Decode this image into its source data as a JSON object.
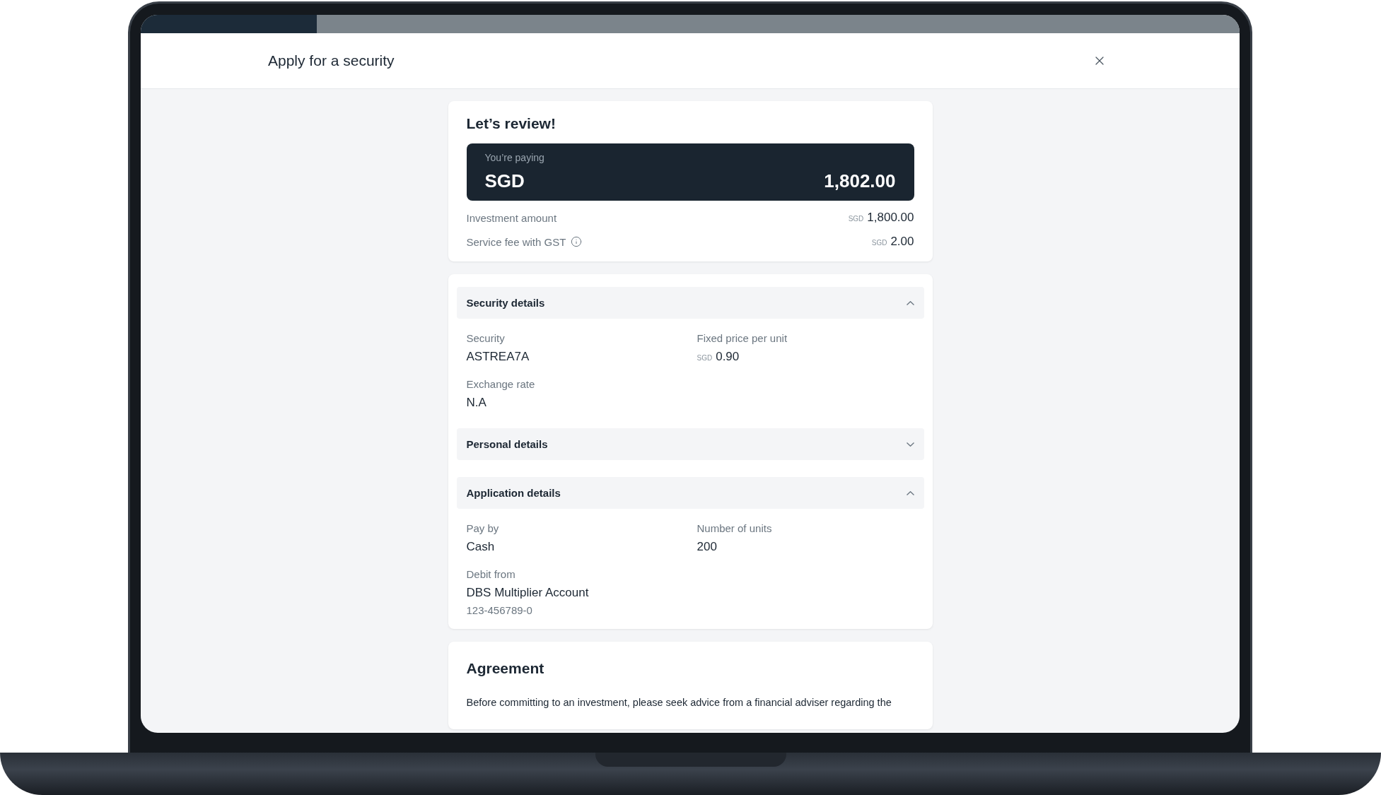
{
  "progress": {
    "level": 0.16
  },
  "header": {
    "title": "Apply for a security"
  },
  "review": {
    "title": "Let’s review!",
    "paying": {
      "label": "You’re paying",
      "currency": "SGD",
      "amount": "1,802.00"
    },
    "rows": [
      {
        "label": "Investment amount",
        "info": false,
        "currency": "SGD",
        "amount": "1,800.00"
      },
      {
        "label": "Service fee with GST",
        "info": true,
        "currency": "SGD",
        "amount": "2.00"
      }
    ]
  },
  "sections": [
    {
      "title": "Security details",
      "expanded": true,
      "fields": [
        {
          "label": "Security",
          "value": "ASTREA7A"
        },
        {
          "label": "Fixed price per unit",
          "currency": "SGD",
          "value": "0.90"
        },
        {
          "label": "Exchange rate",
          "value": "N.A"
        }
      ]
    },
    {
      "title": "Personal details",
      "expanded": false
    },
    {
      "title": "Application details",
      "expanded": true,
      "fields": [
        {
          "label": "Pay by",
          "value": "Cash"
        },
        {
          "label": "Number of units",
          "value": "200"
        },
        {
          "label": "Debit from",
          "value": "DBS Multiplier Account",
          "sub": "123-456789-0"
        }
      ]
    }
  ],
  "agreement": {
    "title": "Agreement",
    "text": "Before committing to an investment, please seek advice from a financial adviser regarding the"
  }
}
